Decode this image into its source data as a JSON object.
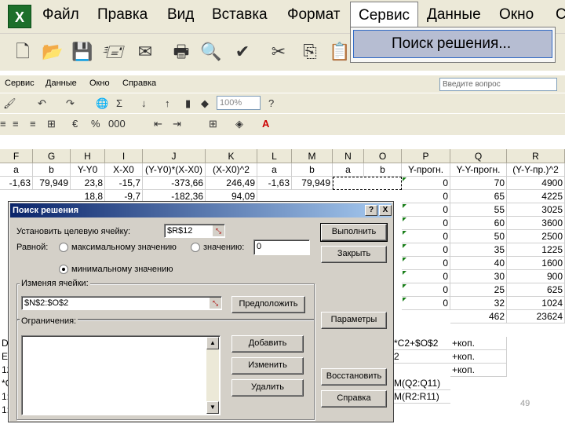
{
  "zoom_menu": [
    "Файл",
    "Правка",
    "Вид",
    "Вставка",
    "Формат",
    "Сервис",
    "Данные",
    "Окно",
    "С"
  ],
  "zoom_dropdown_item": "Поиск решения...",
  "small_menu": [
    "Сервис",
    "Данные",
    "Окно",
    "Справка"
  ],
  "ask_placeholder": "Введите вопрос",
  "zoom_level": "100%",
  "columns": [
    "F",
    "G",
    "H",
    "I",
    "J",
    "K",
    "L",
    "M",
    "N",
    "O",
    "P",
    "Q",
    "R"
  ],
  "header_row": [
    "a",
    "b",
    "Y-Y0",
    "X-X0",
    "(Y-Y0)*(X-X0)",
    "(X-X0)^2",
    "a",
    "b",
    "a",
    "b",
    "Y-прогн.",
    "Y-Y-прогн.",
    "(Y-Y-пр.)^2"
  ],
  "row1": [
    "-1,63",
    "79,949",
    "23,8",
    "-15,7",
    "-373,66",
    "246,49",
    "-1,63",
    "79,949",
    "",
    "",
    "0",
    "70",
    "4900"
  ],
  "row2": [
    "",
    "",
    "18,8",
    "-9,7",
    "-182,36",
    "94,09"
  ],
  "p_col": [
    "0",
    "0",
    "0",
    "0",
    "0",
    "0",
    "0",
    "0",
    "0"
  ],
  "q_col": [
    "65",
    "55",
    "60",
    "50",
    "35",
    "40",
    "30",
    "25",
    "32",
    "462"
  ],
  "r_col": [
    "4225",
    "3025",
    "3600",
    "2500",
    "1225",
    "1600",
    "900",
    "625",
    "1024",
    "23624"
  ],
  "formula_cells": [
    "*C2+$O$2",
    "2",
    "M(Q2:Q11)",
    "M(R2:R11)"
  ],
  "kop_cells": [
    "+коп.",
    "+коп.",
    "+коп."
  ],
  "left_frag": [
    "D",
    "E",
    "12",
    "*C",
    "1:",
    "1:"
  ],
  "dialog": {
    "title": "Поиск решения",
    "help": "?",
    "close": "X",
    "target_label": "Установить целевую ячейку:",
    "target_value": "$R$12",
    "equal_label": "Равной:",
    "max_label": "максимальному значению",
    "value_label": "значению:",
    "value_input": "0",
    "min_label": "минимальному значению",
    "changing_label": "Изменяя ячейки:",
    "changing_value": "$N$2:$O$2",
    "constraints_label": "Ограничения:",
    "btn_run": "Выполнить",
    "btn_close": "Закрыть",
    "btn_guess": "Предположить",
    "btn_params": "Параметры",
    "btn_add": "Добавить",
    "btn_change": "Изменить",
    "btn_delete": "Удалить",
    "btn_reset": "Восстановить",
    "btn_help": "Справка"
  },
  "page_number": "49"
}
